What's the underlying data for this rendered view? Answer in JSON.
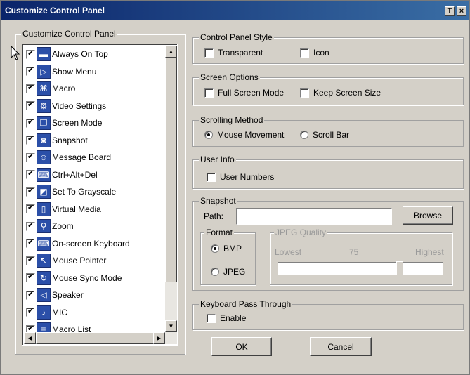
{
  "window": {
    "title": "Customize Control Panel",
    "help_glyph": "T",
    "close_glyph": "×"
  },
  "list_group": {
    "legend": "Customize Control Panel",
    "items": [
      {
        "label": "Always On Top",
        "checked": true,
        "icon": "pin-icon",
        "glyph": "▬"
      },
      {
        "label": "Show Menu",
        "checked": true,
        "icon": "menu-arrow-icon",
        "glyph": "▷"
      },
      {
        "label": "Macro",
        "checked": true,
        "icon": "macro-icon",
        "glyph": "⌘"
      },
      {
        "label": "Video Settings",
        "checked": true,
        "icon": "video-settings-icon",
        "glyph": "⚙"
      },
      {
        "label": "Screen Mode",
        "checked": true,
        "icon": "screen-mode-icon",
        "glyph": "❐"
      },
      {
        "label": "Snapshot",
        "checked": true,
        "icon": "camera-icon",
        "glyph": "◙"
      },
      {
        "label": "Message Board",
        "checked": true,
        "icon": "message-board-icon",
        "glyph": "☺"
      },
      {
        "label": "Ctrl+Alt+Del",
        "checked": true,
        "icon": "keyboard-keys-icon",
        "glyph": "⌨"
      },
      {
        "label": "Set To Grayscale",
        "checked": true,
        "icon": "grayscale-icon",
        "glyph": "◩"
      },
      {
        "label": "Virtual Media",
        "checked": true,
        "icon": "usb-media-icon",
        "glyph": "▯"
      },
      {
        "label": "Zoom",
        "checked": true,
        "icon": "magnifier-icon",
        "glyph": "⚲"
      },
      {
        "label": "On-screen Keyboard",
        "checked": true,
        "icon": "onscreen-keyboard-icon",
        "glyph": "⌨"
      },
      {
        "label": "Mouse Pointer",
        "checked": true,
        "icon": "mouse-pointer-icon",
        "glyph": "↖"
      },
      {
        "label": "Mouse Sync Mode",
        "checked": true,
        "icon": "mouse-sync-icon",
        "glyph": "↻"
      },
      {
        "label": "Speaker",
        "checked": true,
        "icon": "speaker-icon",
        "glyph": "◁"
      },
      {
        "label": "MIC",
        "checked": true,
        "icon": "microphone-icon",
        "glyph": "♪"
      },
      {
        "label": "Macro List",
        "checked": true,
        "icon": "macro-list-icon",
        "glyph": "≡"
      }
    ]
  },
  "control_panel_style": {
    "legend": "Control Panel Style",
    "transparent": {
      "label": "Transparent",
      "checked": false
    },
    "icon": {
      "label": "Icon",
      "checked": false
    }
  },
  "screen_options": {
    "legend": "Screen Options",
    "full_screen": {
      "label": "Full Screen Mode",
      "checked": false
    },
    "keep_size": {
      "label": "Keep Screen Size",
      "checked": false
    }
  },
  "scrolling_method": {
    "legend": "Scrolling Method",
    "mouse_movement": {
      "label": "Mouse Movement",
      "selected": true
    },
    "scroll_bar": {
      "label": "Scroll Bar",
      "selected": false
    }
  },
  "user_info": {
    "legend": "User Info",
    "user_numbers": {
      "label": "User Numbers",
      "checked": false
    }
  },
  "snapshot": {
    "legend": "Snapshot",
    "path_label": "Path:",
    "path_value": "",
    "browse_label": "Browse",
    "format": {
      "legend": "Format",
      "bmp": {
        "label": "BMP",
        "selected": true
      },
      "jpeg": {
        "label": "JPEG",
        "selected": false
      }
    },
    "jpeg_quality": {
      "legend": "JPEG Quality",
      "lowest_label": "Lowest",
      "value_label": "75",
      "highest_label": "Highest",
      "value": 75
    }
  },
  "keyboard_pass_through": {
    "legend": "Keyboard Pass Through",
    "enable": {
      "label": "Enable",
      "checked": false
    }
  },
  "buttons": {
    "ok": "OK",
    "cancel": "Cancel"
  }
}
